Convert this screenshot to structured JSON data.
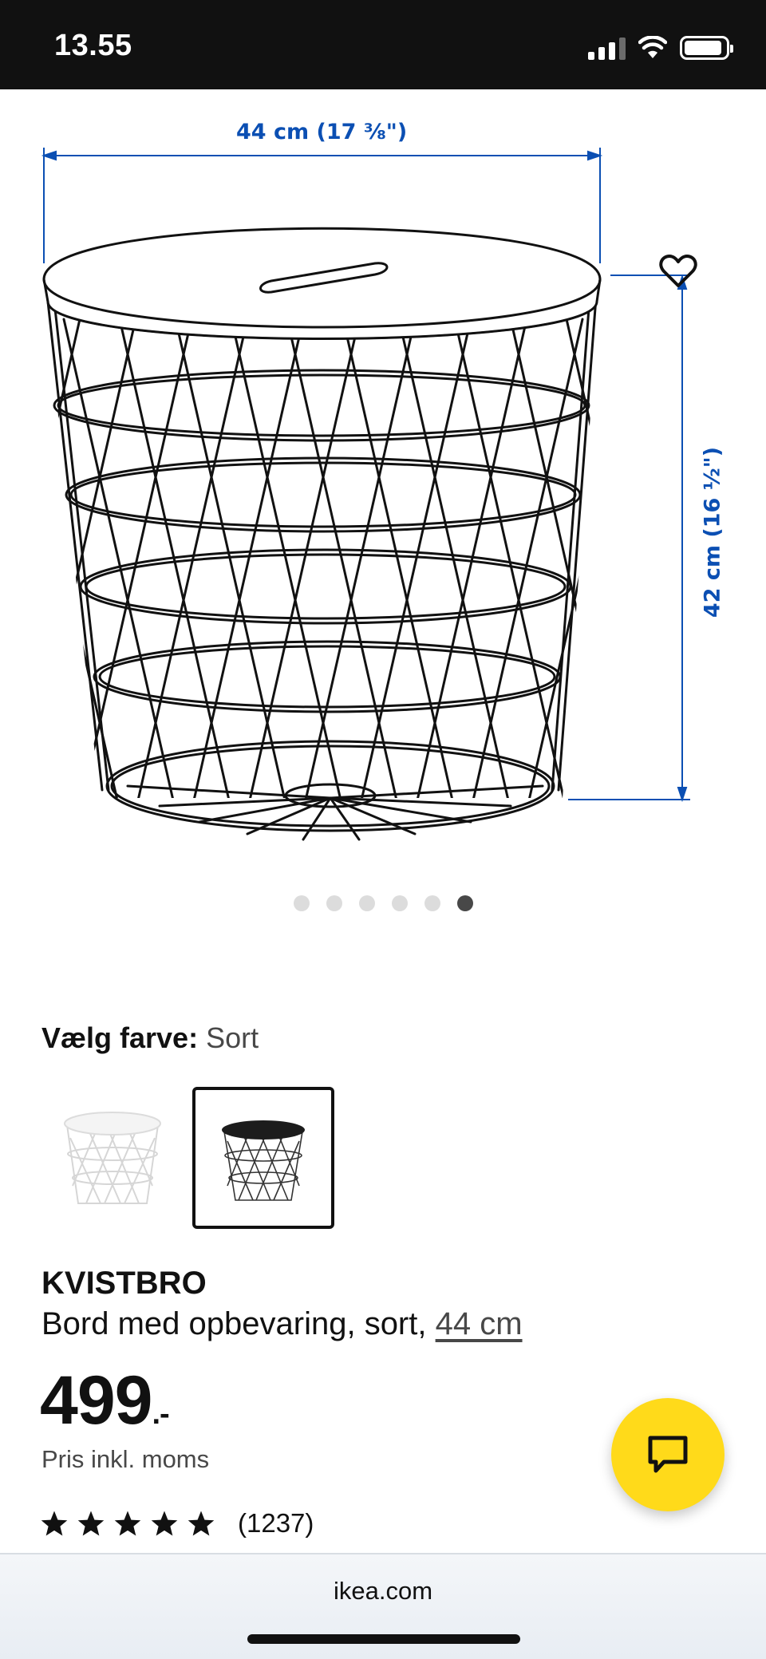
{
  "status_bar": {
    "time": "13.55",
    "icons": [
      "cellular-signal-icon",
      "wifi-icon",
      "battery-icon"
    ]
  },
  "product_image": {
    "dimension_width": "44 cm (17 ⅜\")",
    "dimension_height": "42 cm (16 ½\")",
    "dimension_color": "#0b4fb3",
    "favorite_icon": "heart-icon",
    "pager": {
      "total": 6,
      "active_index": 5
    }
  },
  "color_select": {
    "label": "Vælg farve:",
    "value": "Sort",
    "options": [
      {
        "name": "white",
        "selected": false
      },
      {
        "name": "black",
        "selected": true
      }
    ]
  },
  "product": {
    "name": "KVISTBRO",
    "description": "Bord med opbevaring, sort,",
    "size_link": "44 cm",
    "price": "499",
    "price_suffix": ".-",
    "price_note": "Pris inkl. moms",
    "rating": {
      "stars": 5,
      "count": "(1237)"
    }
  },
  "chat": {
    "icon": "chat-bubble-icon",
    "color": "#ffda1a"
  },
  "browser": {
    "url": "ikea.com"
  }
}
